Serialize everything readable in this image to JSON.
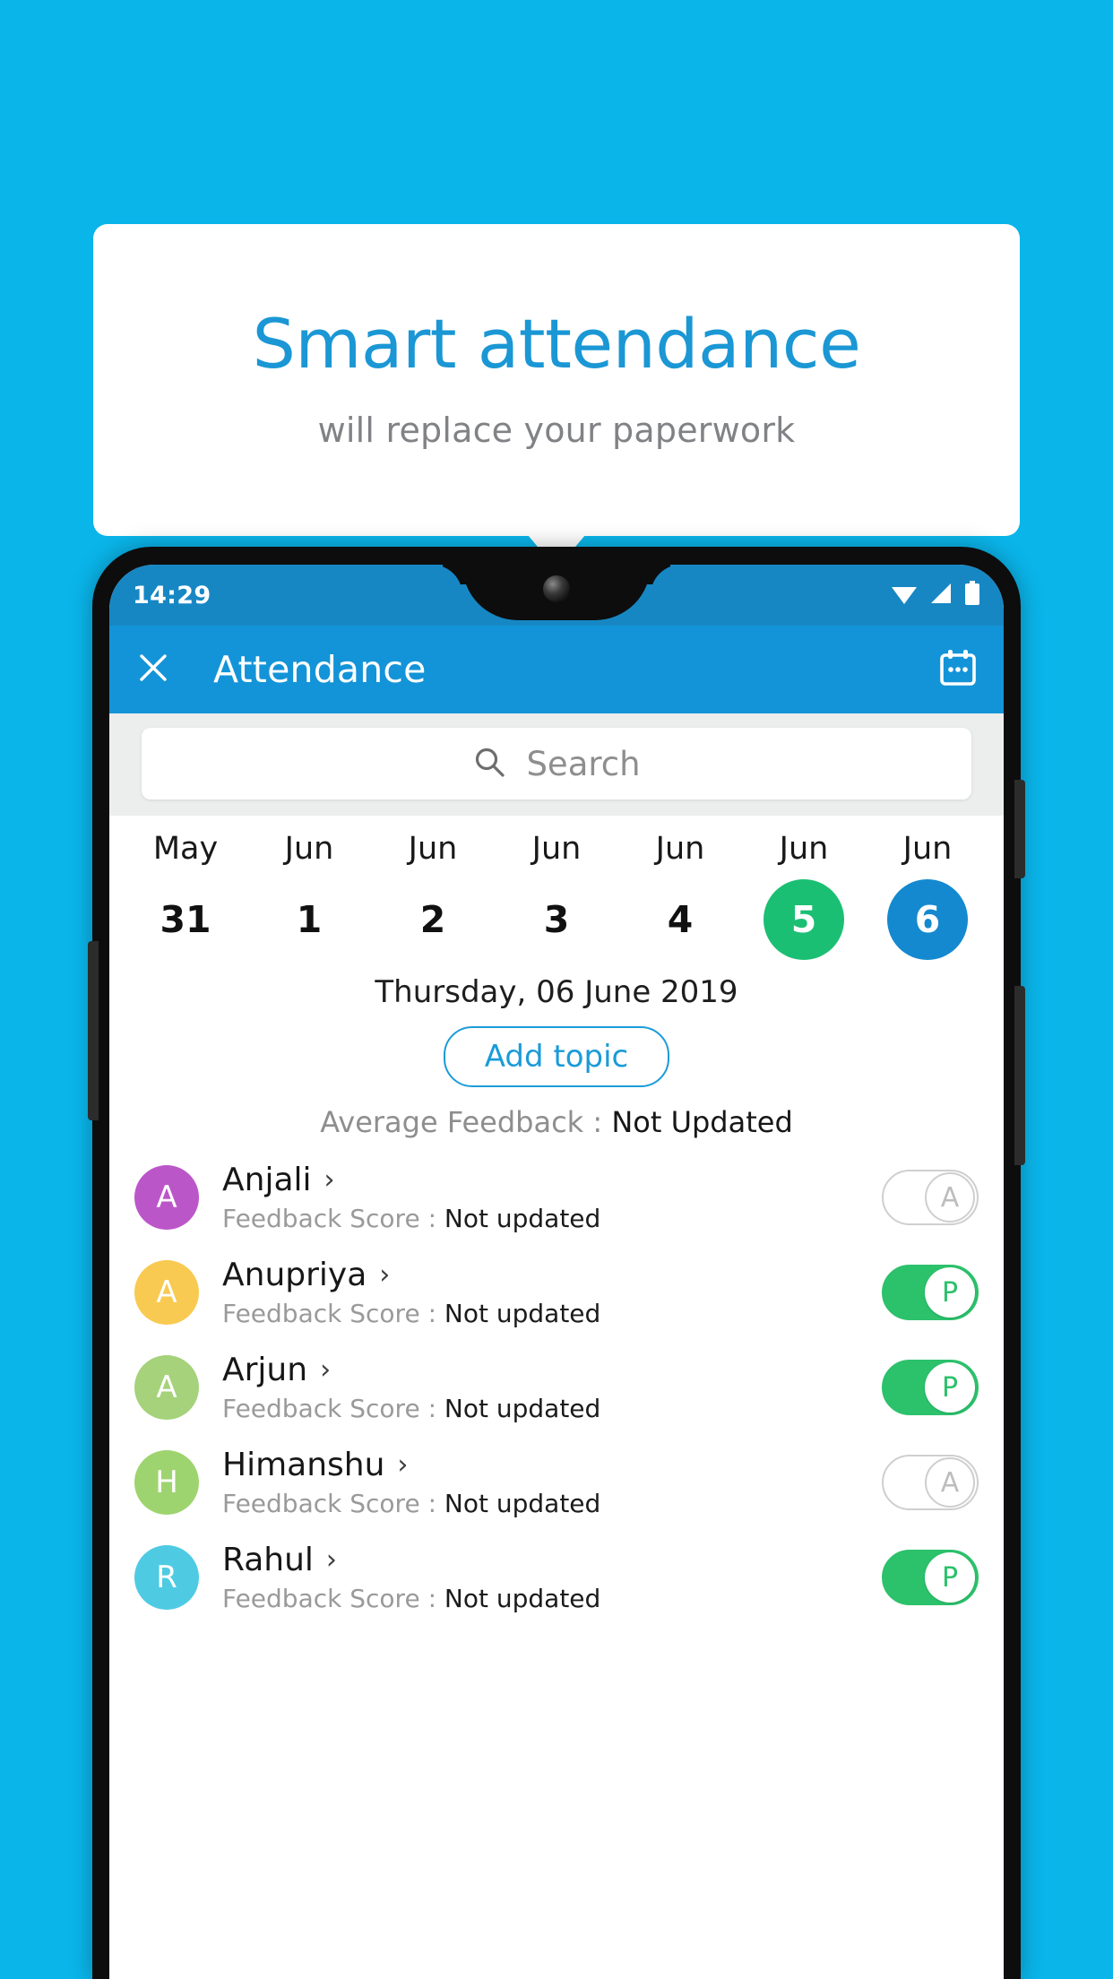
{
  "promo": {
    "title": "Smart attendance",
    "subtitle": "will replace your paperwork",
    "title_color": "#1a97d4",
    "subtitle_color": "#808285",
    "background_color": "#0ab5ea"
  },
  "phone": {
    "status_bar": {
      "time": "14:29",
      "icons": [
        "wifi-icon",
        "signal-icon",
        "battery-icon"
      ],
      "background_color": "#1787c4"
    },
    "app_bar": {
      "close_label": "✕",
      "title": "Attendance",
      "calendar_icon": "calendar-icon",
      "background_color": "#1494d8"
    },
    "search": {
      "placeholder": "Search",
      "icon": "search-icon"
    },
    "date_strip": [
      {
        "month": "May",
        "day": "31",
        "highlight": "none"
      },
      {
        "month": "Jun",
        "day": "1",
        "highlight": "none"
      },
      {
        "month": "Jun",
        "day": "2",
        "highlight": "none"
      },
      {
        "month": "Jun",
        "day": "3",
        "highlight": "none"
      },
      {
        "month": "Jun",
        "day": "4",
        "highlight": "none"
      },
      {
        "month": "Jun",
        "day": "5",
        "highlight": "green"
      },
      {
        "month": "Jun",
        "day": "6",
        "highlight": "blue"
      }
    ],
    "highlight_colors": {
      "green": "#1bbf73",
      "blue": "#1489cf"
    },
    "selected_date": "Thursday, 06 June 2019",
    "add_topic_label": "Add topic",
    "average_feedback_label": "Average Feedback : ",
    "average_feedback_value": "Not Updated",
    "score_label": "Feedback Score : ",
    "students": [
      {
        "name": "Anjali",
        "initial": "A",
        "avatar_color": "#bb56c9",
        "score_value": "Not updated",
        "status": "A",
        "status_name": "absent",
        "chevron": "›"
      },
      {
        "name": "Anupriya",
        "initial": "A",
        "avatar_color": "#f8ca51",
        "score_value": "Not updated",
        "status": "P",
        "status_name": "present",
        "chevron": "›"
      },
      {
        "name": "Arjun",
        "initial": "A",
        "avatar_color": "#a5d27a",
        "score_value": "Not updated",
        "status": "P",
        "status_name": "present",
        "chevron": "›"
      },
      {
        "name": "Himanshu",
        "initial": "H",
        "avatar_color": "#9ed46f",
        "score_value": "Not updated",
        "status": "A",
        "status_name": "absent",
        "chevron": "›"
      },
      {
        "name": "Rahul",
        "initial": "R",
        "avatar_color": "#4ecbe3",
        "score_value": "Not updated",
        "status": "P",
        "status_name": "present",
        "chevron": "›"
      }
    ]
  }
}
